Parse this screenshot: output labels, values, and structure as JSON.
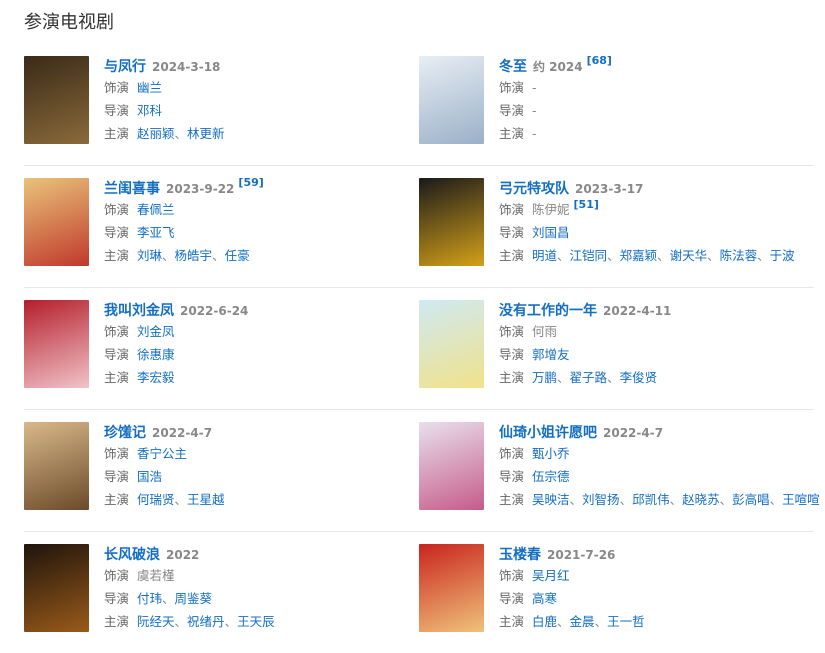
{
  "section": {
    "title": "参演电视剧"
  },
  "labels": {
    "role": "饰演",
    "director": "导演",
    "cast": "主演"
  },
  "colors": {
    "link": "#136ec2",
    "label": "#666666",
    "muted": "#888888"
  },
  "shows": [
    {
      "title": "与凤行",
      "date": "2024-3-18",
      "ref": "",
      "role": "幽兰",
      "director": "邓科",
      "cast": "赵丽颖、林更新",
      "poster_colors": [
        "#3a2a18",
        "#8a6a3a"
      ]
    },
    {
      "title": "冬至",
      "date": "约 2024",
      "ref": "[68]",
      "role": "-",
      "director": "-",
      "cast": "-",
      "poster_colors": [
        "#e8eef4",
        "#9ab0c8"
      ],
      "plain": true
    },
    {
      "title": "兰闺喜事",
      "date": "2023-9-22",
      "ref": "[59]",
      "role": "春佩兰",
      "director": "李亚飞",
      "cast": "刘琳、杨皓宇、任豪",
      "poster_colors": [
        "#e9c37a",
        "#c0392b"
      ]
    },
    {
      "title": "弓元特攻队",
      "date": "2023-3-17",
      "ref": "",
      "role": "陈伊妮",
      "role_ref": "[51]",
      "role_plain": true,
      "director": "刘国昌",
      "cast": "明道、江铠同、郑嘉颖、谢天华、陈法蓉、于波",
      "poster_colors": [
        "#1a1a1a",
        "#d4a017"
      ]
    },
    {
      "title": "我叫刘金凤",
      "date": "2022-6-24",
      "ref": "",
      "role": "刘金凤",
      "director": "徐惠康",
      "cast": "李宏毅",
      "poster_colors": [
        "#b41e2b",
        "#f2c3c9"
      ]
    },
    {
      "title": "没有工作的一年",
      "date": "2022-4-11",
      "ref": "",
      "role": "何雨",
      "role_plain": true,
      "director": "郭增友",
      "cast": "万鹏、翟子路、李俊贤",
      "poster_colors": [
        "#cfe9f3",
        "#f1e28a"
      ]
    },
    {
      "title": "珍馐记",
      "date": "2022-4-7",
      "ref": "",
      "role": "香宁公主",
      "director": "国浩",
      "cast": "何瑞贤、王星越",
      "poster_colors": [
        "#d9b98a",
        "#6b4a2a"
      ]
    },
    {
      "title": "仙琦小姐许愿吧",
      "date": "2022-4-7",
      "ref": "",
      "role": "甄小乔",
      "director": "伍宗德",
      "cast": "吴映洁、刘智扬、邱凯伟、赵晓苏、彭高唱、王喧喧",
      "poster_colors": [
        "#e8e0ec",
        "#c65b8a"
      ]
    },
    {
      "title": "长风破浪",
      "date": "2022",
      "ref": "",
      "role": "虞若槿",
      "role_plain": true,
      "director": "付玮、周鉴葵",
      "cast": "阮经天、祝绪丹、王天辰",
      "poster_colors": [
        "#1e140c",
        "#9a5a1a"
      ]
    },
    {
      "title": "玉楼春",
      "date": "2021-7-26",
      "ref": "",
      "role": "吴月红",
      "director": "高寒",
      "cast": "白鹿、金晨、王一哲",
      "poster_colors": [
        "#c9241e",
        "#f0c27a"
      ]
    }
  ]
}
